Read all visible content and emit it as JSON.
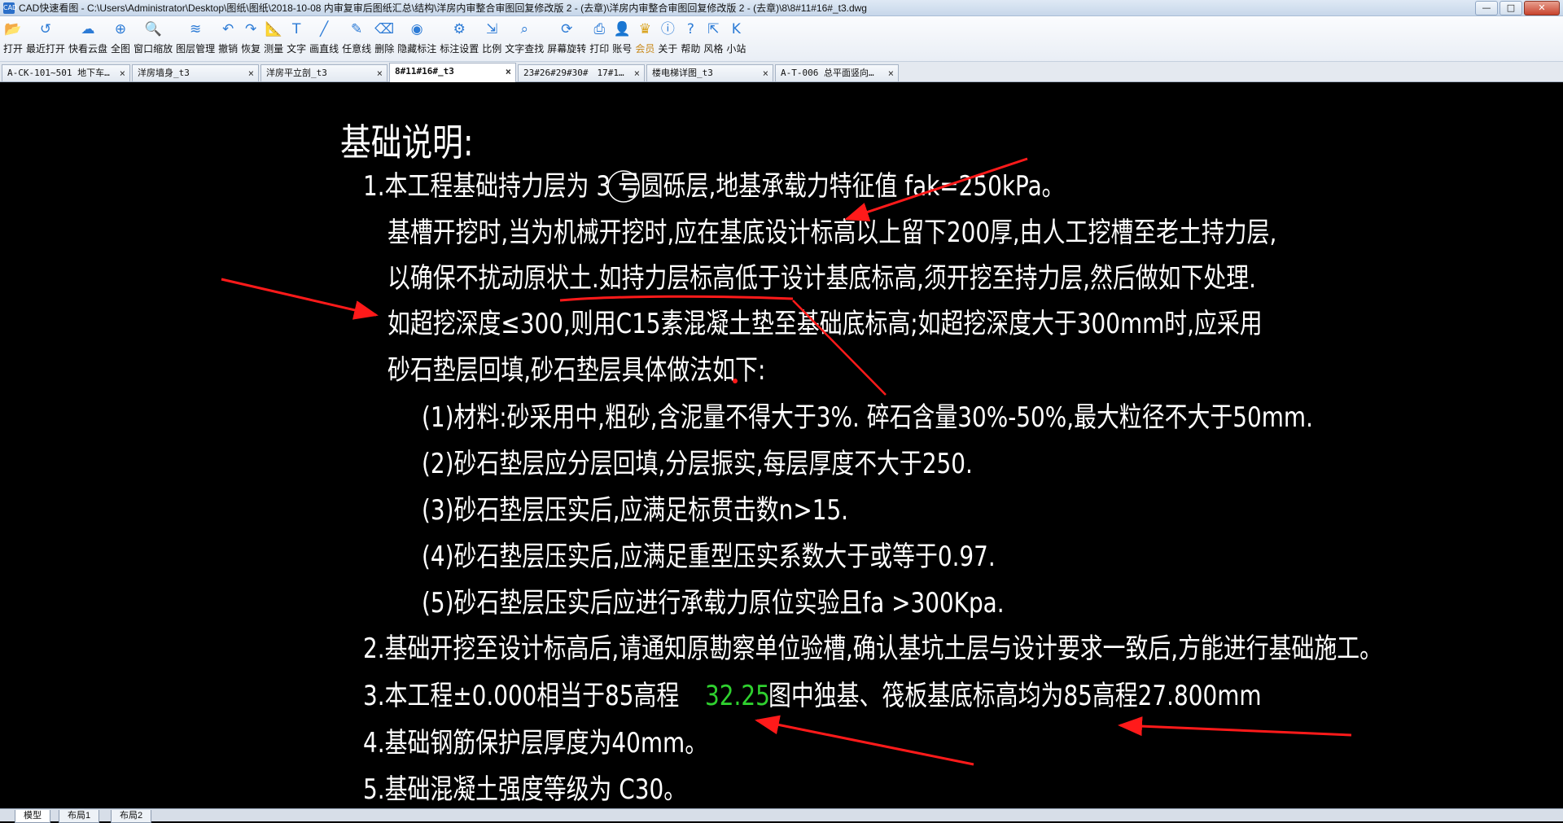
{
  "window": {
    "title": "CAD快速看图 - C:\\Users\\Administrator\\Desktop\\图纸\\图纸\\2018-10-08 内审复审后图纸汇总\\结构\\洋房内审整合审图回复修改版 2 - (去章)\\洋房内审整合审图回复修改版 2 - (去章)\\8\\8#11#16#_t3.dwg",
    "icon_text": "CAD",
    "min_label": "—",
    "max_label": "□",
    "close_label": "✕"
  },
  "toolbar": [
    {
      "name": "open",
      "label": "打开",
      "icon": "folder-icon",
      "glyph": "📂"
    },
    {
      "name": "recent",
      "label": "最近打开",
      "icon": "history-icon",
      "glyph": "↺"
    },
    {
      "name": "cloud",
      "label": "快看云盘",
      "icon": "cloud-icon",
      "glyph": "☁"
    },
    {
      "name": "full",
      "label": "全图",
      "icon": "fullview-icon",
      "glyph": "⊕"
    },
    {
      "name": "zoom",
      "label": "窗口缩放",
      "icon": "zoom-window-icon",
      "glyph": "🔍"
    },
    {
      "name": "layers",
      "label": "图层管理",
      "icon": "layers-icon",
      "glyph": "≋"
    },
    {
      "name": "undo",
      "label": "撤销",
      "icon": "undo-icon",
      "glyph": "↶"
    },
    {
      "name": "redo",
      "label": "恢复",
      "icon": "redo-icon",
      "glyph": "↷"
    },
    {
      "name": "measure",
      "label": "测量",
      "icon": "ruler-icon",
      "glyph": "📐"
    },
    {
      "name": "text",
      "label": "文字",
      "icon": "text-icon",
      "glyph": "T"
    },
    {
      "name": "line",
      "label": "画直线",
      "icon": "line-icon",
      "glyph": "╱"
    },
    {
      "name": "freeline",
      "label": "任意线",
      "icon": "pen-icon",
      "glyph": "✎"
    },
    {
      "name": "delete",
      "label": "删除",
      "icon": "eraser-icon",
      "glyph": "⌫"
    },
    {
      "name": "hide",
      "label": "隐藏标注",
      "icon": "eye-icon",
      "glyph": "◉"
    },
    {
      "name": "annset",
      "label": "标注设置",
      "icon": "annotation-settings-icon",
      "glyph": "⚙"
    },
    {
      "name": "scale",
      "label": "比例",
      "icon": "scale-icon",
      "glyph": "⇲"
    },
    {
      "name": "find",
      "label": "文字查找",
      "icon": "text-search-icon",
      "glyph": "⌕"
    },
    {
      "name": "rotate",
      "label": "屏幕旋转",
      "icon": "rotate-icon",
      "glyph": "⟳"
    },
    {
      "name": "print",
      "label": "打印",
      "icon": "printer-icon",
      "glyph": "⎙"
    },
    {
      "name": "account",
      "label": "账号",
      "icon": "user-icon",
      "glyph": "👤"
    },
    {
      "name": "vip",
      "label": "会员",
      "icon": "vip-icon",
      "glyph": "♛"
    },
    {
      "name": "about",
      "label": "关于",
      "icon": "info-icon",
      "glyph": "ⓘ"
    },
    {
      "name": "help",
      "label": "帮助",
      "icon": "help-icon",
      "glyph": "?"
    },
    {
      "name": "style",
      "label": "风格",
      "icon": "style-icon",
      "glyph": "⇱"
    },
    {
      "name": "site",
      "label": "小站",
      "icon": "site-icon",
      "glyph": "K"
    }
  ],
  "tabs": [
    {
      "label": "A-CK-101~501 地下车…",
      "active": false
    },
    {
      "label": "洋房墙身_t3",
      "active": false
    },
    {
      "label": "洋房平立剖_t3",
      "active": false
    },
    {
      "label": "8#11#16#_t3",
      "active": true
    },
    {
      "label": "23#26#29#30#　17#1…",
      "active": false
    },
    {
      "label": "楼电梯详图_t3",
      "active": false
    },
    {
      "label": "A-T-006 总平面竖向…",
      "active": false
    }
  ],
  "drawing": {
    "heading": "基础说明:",
    "lines": [
      "1.本工程基础持力层为  3  号圆砾层,地基承载力特征值 fak=250kPa。",
      "基槽开挖时,当为机械开挖时,应在基底设计标高以上留下200厚,由人工挖槽至老土持力层,",
      "以确保不扰动原状土.如持力层标高低于设计基底标高,须开挖至持力层,然后做如下处理.",
      "如超挖深度≤300,则用C15素混凝土垫至基础底标高;如超挖深度大于300mm时,应采用",
      "砂石垫层回填,砂石垫层具体做法如下:",
      "(1)材料:砂采用中,粗砂,含泥量不得大于3%. 碎石含量30%-50%,最大粒径不大于50mm.",
      "(2)砂石垫层应分层回填,分层振实,每层厚度不大于250.",
      "(3)砂石垫层压实后,应满足标贯击数n>15.",
      "(4)砂石垫层压实后,应满足重型压实系数大于或等于0.97.",
      "(5)砂石垫层压实后应进行承载力原位实验且fa >300Kpa.",
      "2.基础开挖至设计标高后,请通知原勘察单位验槽,确认基坑土层与设计要求一致后,方能进行基础施工。",
      "3.本工程±0.000相当于85高程",
      "4.基础钢筋保护层厚度为40mm。",
      "5.基础混凝土强度等级为 C30。"
    ],
    "line3_green": "32.25",
    "line3_tail": "图中独基、筏板基底标高均为85高程27.800mm"
  },
  "layout_tabs": [
    {
      "label": "模型",
      "active": true
    },
    {
      "label": "布局1",
      "active": false
    },
    {
      "label": "布局2",
      "active": false
    }
  ]
}
